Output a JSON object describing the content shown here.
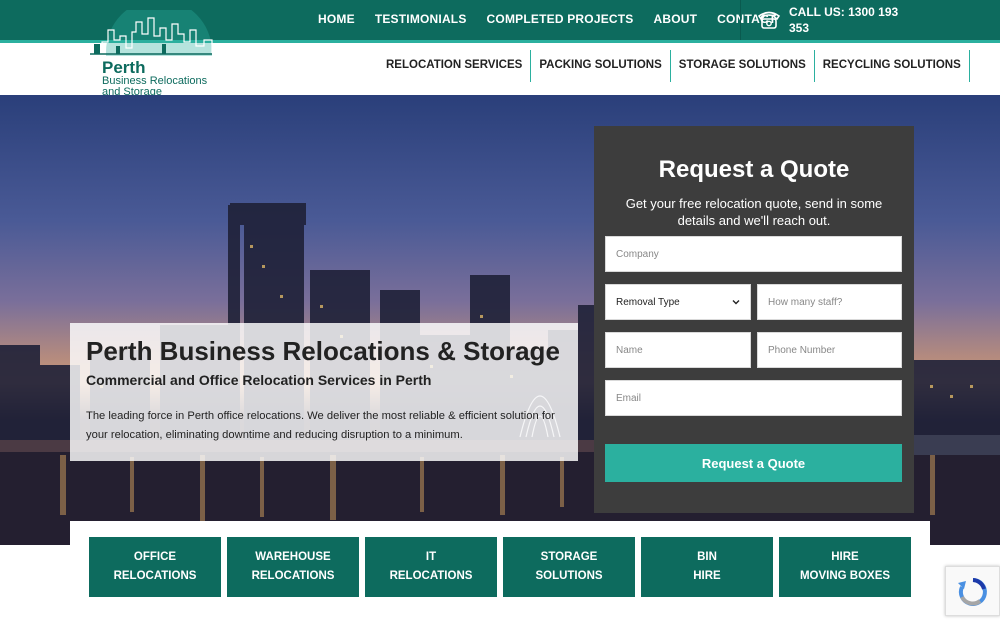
{
  "header": {
    "top_nav": [
      "HOME",
      "TESTIMONIALS",
      "COMPLETED PROJECTS",
      "ABOUT",
      "CONTACT"
    ],
    "call_label": "CALL US: 1300 193 353",
    "logo": {
      "line1": "Perth",
      "line2": "Business Relocations",
      "line3": "and Storage"
    },
    "services_nav": [
      "RELOCATION SERVICES",
      "PACKING SOLUTIONS",
      "STORAGE SOLUTIONS",
      "RECYCLING SOLUTIONS"
    ]
  },
  "hero": {
    "title": "Perth Business Relocations & Storage",
    "subtitle": "Commercial and Office Relocation Services in Perth",
    "description": "The leading force in Perth office relocations. We deliver the most reliable & efficient solution for your relocation, eliminating downtime and reducing disruption to a minimum."
  },
  "quote_form": {
    "title": "Request a Quote",
    "subtitle": "Get your free relocation quote, send in some details and we'll reach out.",
    "company_placeholder": "Company",
    "removal_type_selected": "Removal Type",
    "staff_placeholder": "How many staff?",
    "name_placeholder": "Name",
    "phone_placeholder": "Phone Number",
    "email_placeholder": "Email",
    "submit_label": "Request a Quote"
  },
  "service_tiles": [
    {
      "line1": "OFFICE",
      "line2": "RELOCATIONS"
    },
    {
      "line1": "WAREHOUSE",
      "line2": "RELOCATIONS"
    },
    {
      "line1": "IT",
      "line2": "RELOCATIONS"
    },
    {
      "line1": "STORAGE",
      "line2": "SOLUTIONS"
    },
    {
      "line1": "BIN",
      "line2": "HIRE"
    },
    {
      "line1": "HIRE",
      "line2": "MOVING BOXES"
    }
  ],
  "colors": {
    "brand_dark": "#0d6b5e",
    "brand_accent": "#2bb09f",
    "panel": "#3d3d3d"
  }
}
